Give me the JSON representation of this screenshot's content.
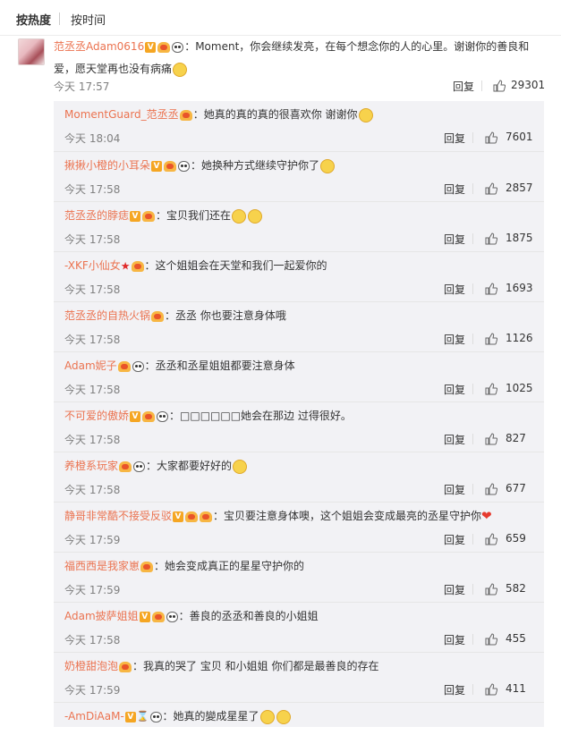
{
  "tabs": {
    "hot": "按热度",
    "time": "按时间"
  },
  "main": {
    "username": "范丞丞Adam0616",
    "text": "：Moment，你会继续发亮，在每个想念你的人的心里。谢谢你的善良和爱，愿天堂再也没有病痛",
    "time": "今天 17:57",
    "reply": "回复",
    "likes": "29301"
  },
  "replies": [
    {
      "username": "MomentGuard_范丞丞",
      "text": "：她真的真的真的很喜欢你 谢谢你",
      "time": "今天 18:04",
      "reply": "回复",
      "likes": "7601"
    },
    {
      "username": "揪揪小橙的小耳朵",
      "text": "：她换种方式继续守护你了",
      "time": "今天 17:58",
      "reply": "回复",
      "likes": "2857"
    },
    {
      "username": "范丞丞的脖痣",
      "text": "：宝贝我们还在",
      "time": "今天 17:58",
      "reply": "回复",
      "likes": "1875"
    },
    {
      "username": "-XKF小仙女",
      "text": "：这个姐姐会在天堂和我们一起爱你的",
      "time": "今天 17:58",
      "reply": "回复",
      "likes": "1693"
    },
    {
      "username": "范丞丞的自热火锅",
      "text": "：丞丞 你也要注意身体哦",
      "time": "今天 17:58",
      "reply": "回复",
      "likes": "1126"
    },
    {
      "username": "Adam妮子",
      "text": "：丞丞和丞星姐姐都要注意身体",
      "time": "今天 17:58",
      "reply": "回复",
      "likes": "1025"
    },
    {
      "username": "不可爱的傲娇",
      "text": "：□□□□□□她会在那边 过得很好。",
      "time": "今天 17:58",
      "reply": "回复",
      "likes": "827"
    },
    {
      "username": "养橙系玩家",
      "text": "：大家都要好好的",
      "time": "今天 17:58",
      "reply": "回复",
      "likes": "677"
    },
    {
      "username": "静哥非常酷不接受反驳",
      "text": "：宝贝要注意身体噢，这个姐姐会变成最亮的丞星守护你",
      "time": "今天 17:59",
      "reply": "回复",
      "likes": "659"
    },
    {
      "username": "福西西是我家崽",
      "text": "：她会变成真正的星星守护你的",
      "time": "今天 17:59",
      "reply": "回复",
      "likes": "582"
    },
    {
      "username": "Adam披萨姐姐",
      "text": "：善良的丞丞和善良的小姐姐",
      "time": "今天 17:58",
      "reply": "回复",
      "likes": "455"
    },
    {
      "username": "奶橙甜泡泡",
      "text": "：我真的哭了 宝贝 和小姐姐 你们都是最善良的存在",
      "time": "今天 17:59",
      "reply": "回复",
      "likes": "411"
    },
    {
      "username": "-AmDiAaM-",
      "text": "：她真的變成星星了",
      "time": "",
      "reply": "",
      "likes": ""
    }
  ],
  "colors": {
    "username": "#eb7350",
    "meta": "#808080",
    "reply_bg": "#f2f2f5"
  }
}
